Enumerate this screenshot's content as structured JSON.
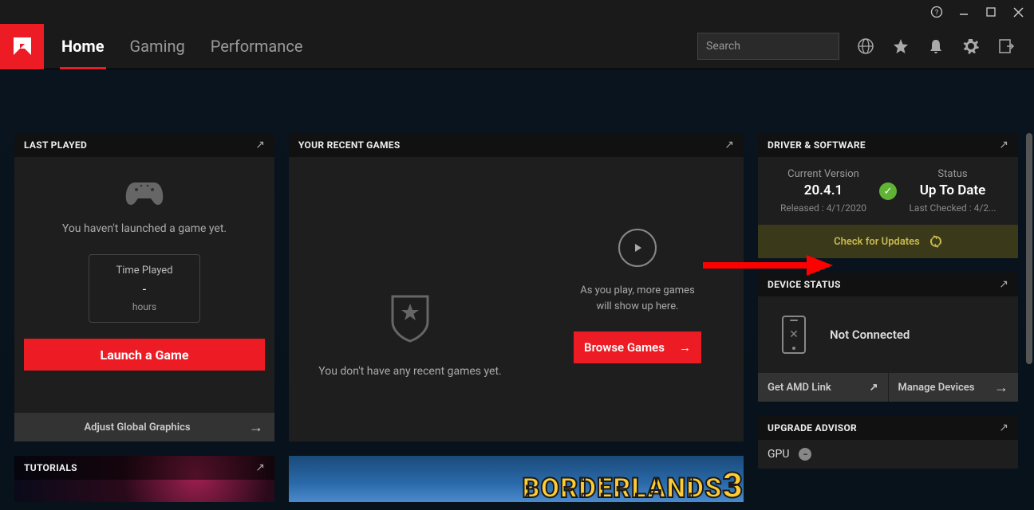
{
  "nav": {
    "home": "Home",
    "gaming": "Gaming",
    "performance": "Performance"
  },
  "search": {
    "placeholder": "Search"
  },
  "panels": {
    "lastPlayed": {
      "title": "LAST PLAYED",
      "noGame": "You haven't launched a game yet.",
      "timePlayedLabel": "Time Played",
      "timePlayedValue": "-",
      "timePlayedUnit": "hours",
      "launchBtn": "Launch a Game",
      "footer": "Adjust Global Graphics"
    },
    "recentGames": {
      "title": "YOUR RECENT GAMES",
      "noGames": "You don't have any recent games yet.",
      "desc1": "As you play, more games",
      "desc2": "will show up here.",
      "browseBtn": "Browse Games"
    },
    "driverSoftware": {
      "title": "DRIVER & SOFTWARE",
      "currentVersionLabel": "Current Version",
      "currentVersionValue": "20.4.1",
      "releasedLabel": "Released : 4/1/2020",
      "statusLabel": "Status",
      "statusValue": "Up To Date",
      "lastChecked": "Last Checked : 4/2...",
      "checkUpdates": "Check for Updates"
    },
    "deviceStatus": {
      "title": "DEVICE STATUS",
      "notConnected": "Not Connected",
      "getLink": "Get AMD Link",
      "manageDevices": "Manage Devices"
    },
    "tutorials": {
      "title": "TUTORIALS"
    },
    "upgradeAdvisor": {
      "title": "UPGRADE ADVISOR",
      "gpuLabel": "GPU"
    },
    "borderlands": {
      "logo": "BORDERLANDS",
      "num": "3"
    }
  }
}
